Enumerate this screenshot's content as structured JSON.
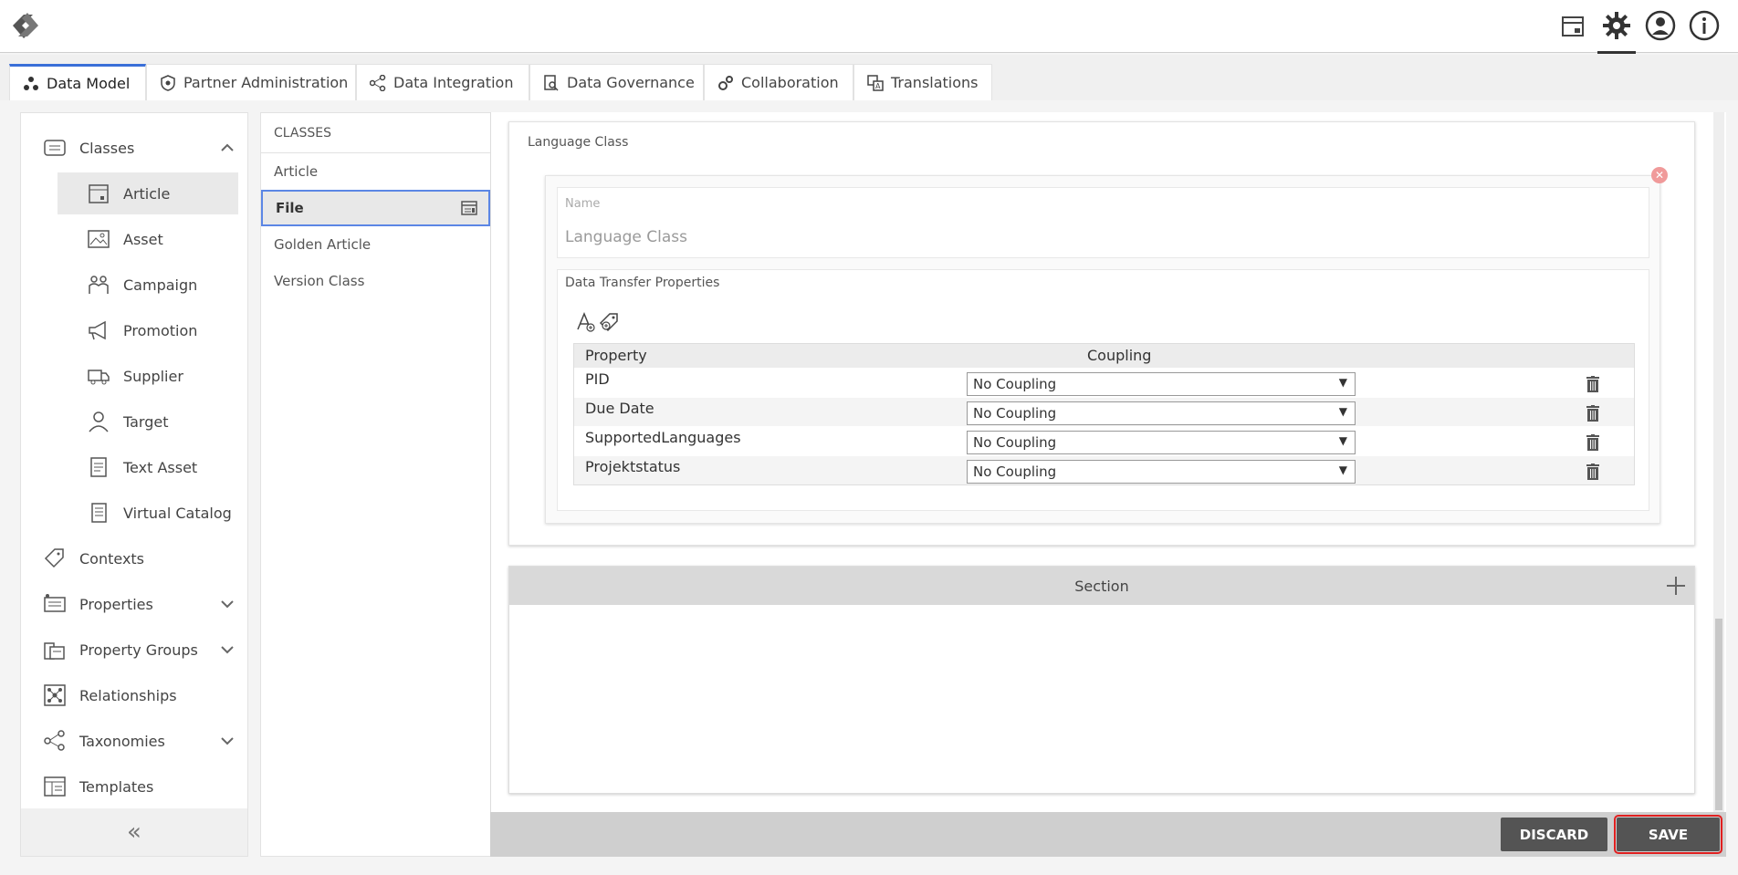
{
  "topbar": {
    "icons": [
      "logo-icon",
      "package-icon",
      "gear-icon",
      "user-icon",
      "info-icon"
    ]
  },
  "tabs": [
    {
      "label": "Data Model",
      "icon": "network-icon",
      "active": true
    },
    {
      "label": "Partner Administration",
      "icon": "shield-icon"
    },
    {
      "label": "Data Integration",
      "icon": "share-icon"
    },
    {
      "label": "Data Governance",
      "icon": "doc-search-icon"
    },
    {
      "label": "Collaboration",
      "icon": "gears-icon"
    },
    {
      "label": "Translations",
      "icon": "translate-icon"
    }
  ],
  "sidebar": {
    "items": [
      {
        "label": "Classes",
        "icon": "classes-icon",
        "expandable": true,
        "expanded": true
      },
      {
        "label": "Article",
        "icon": "article-icon",
        "selected": true
      },
      {
        "label": "Asset",
        "icon": "asset-icon"
      },
      {
        "label": "Campaign",
        "icon": "campaign-icon"
      },
      {
        "label": "Promotion",
        "icon": "megaphone-icon"
      },
      {
        "label": "Supplier",
        "icon": "truck-icon"
      },
      {
        "label": "Target",
        "icon": "target-user-icon"
      },
      {
        "label": "Text Asset",
        "icon": "text-doc-icon"
      },
      {
        "label": "Virtual Catalog",
        "icon": "catalog-icon"
      },
      {
        "label": "Contexts",
        "icon": "tag-icon"
      },
      {
        "label": "Properties",
        "icon": "properties-icon",
        "expandable": true
      },
      {
        "label": "Property Groups",
        "icon": "property-groups-icon",
        "expandable": true
      },
      {
        "label": "Relationships",
        "icon": "relationships-icon"
      },
      {
        "label": "Taxonomies",
        "icon": "taxonomy-icon",
        "expandable": true
      },
      {
        "label": "Templates",
        "icon": "template-icon"
      }
    ],
    "collapse_glyph": "«"
  },
  "classes": {
    "header": "CLASSES",
    "items": [
      "Article",
      "File",
      "Golden Article",
      "Version Class"
    ],
    "selected": "File"
  },
  "language_class": {
    "title": "Language Class",
    "name_label": "Name",
    "name_value": "Language Class",
    "dtp_title": "Data Transfer Properties",
    "columns": {
      "property": "Property",
      "coupling": "Coupling"
    },
    "rows": [
      {
        "property": "PID",
        "coupling": "No Coupling"
      },
      {
        "property": "Due Date",
        "coupling": "No Coupling"
      },
      {
        "property": "SupportedLanguages",
        "coupling": "No Coupling"
      },
      {
        "property": "Projektstatus",
        "coupling": "No Coupling"
      }
    ]
  },
  "section": {
    "title": "Section"
  },
  "footer": {
    "discard_label": "DISCARD",
    "save_label": "SAVE"
  },
  "colors": {
    "accent": "#3a6fd8",
    "button": "#545454",
    "save_outline": "#e02020"
  }
}
